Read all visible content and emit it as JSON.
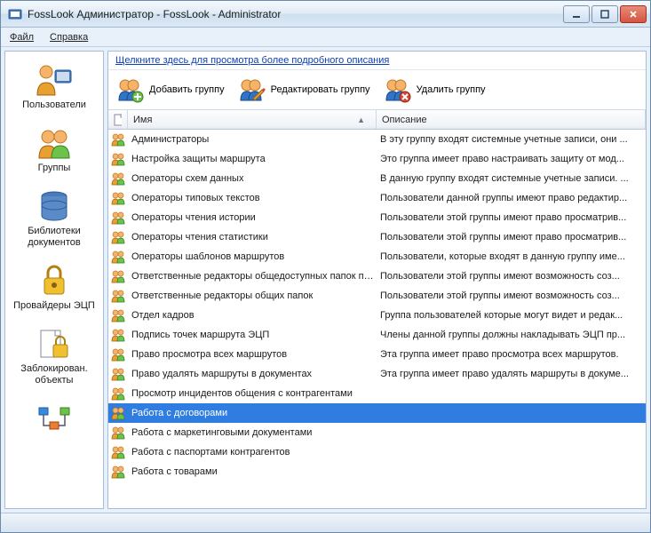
{
  "window": {
    "title": "FossLook Администратор - FossLook - Administrator"
  },
  "menubar": {
    "file": {
      "label": "Файл",
      "underline_index": 0
    },
    "help": {
      "label": "Справка",
      "underline_index": 0
    }
  },
  "sidebar": {
    "items": [
      {
        "icon": "users-icon",
        "label": "Пользователи"
      },
      {
        "icon": "group-icon",
        "label": "Группы"
      },
      {
        "icon": "database-icon",
        "label": "Библиотеки документов"
      },
      {
        "icon": "lock-icon",
        "label": "Провайдеры ЭЦП"
      },
      {
        "icon": "page-lock-icon",
        "label": "Заблокирован. объекты"
      },
      {
        "icon": "tree-icon",
        "label": ""
      }
    ]
  },
  "main": {
    "infolink": "Щелкните здесь для просмотра более подробного описания",
    "toolbar": {
      "add": {
        "label": "Добавить группу"
      },
      "edit": {
        "label": "Редактировать группу"
      },
      "delete": {
        "label": "Удалить группу"
      }
    },
    "columns": {
      "name": "Имя",
      "desc": "Описание"
    },
    "rows": [
      {
        "name": "Администраторы",
        "desc": "В эту группу входят системные учетные записи, они ...",
        "selected": false
      },
      {
        "name": "Настройка защиты маршрута",
        "desc": "Это группа имеет право настраивать защиту от мод...",
        "selected": false
      },
      {
        "name": "Операторы схем данных",
        "desc": "В данную группу входят системные учетные записи. ...",
        "selected": false
      },
      {
        "name": "Операторы типовых текстов",
        "desc": "Пользователи данной группы имеют право редактир...",
        "selected": false
      },
      {
        "name": "Операторы чтения истории",
        "desc": "Пользователи этой группы имеют право просматрив...",
        "selected": false
      },
      {
        "name": "Операторы чтения статистики",
        "desc": "Пользователи этой группы имеют право просматрив...",
        "selected": false
      },
      {
        "name": "Операторы шаблонов маршрутов",
        "desc": "Пользователи, которые входят в данную группу име...",
        "selected": false
      },
      {
        "name": "Ответственные редакторы общедоступных папок по...",
        "desc": "Пользователи этой группы имеют возможность соз...",
        "selected": false
      },
      {
        "name": "Ответственные редакторы общих папок",
        "desc": "Пользователи этой группы имеют возможность соз...",
        "selected": false
      },
      {
        "name": "Отдел кадров",
        "desc": "Группа пользователей которые могут видет и редак...",
        "selected": false
      },
      {
        "name": "Подпись точек маршрута ЭЦП",
        "desc": "Члены данной группы должны накладывать ЭЦП пр...",
        "selected": false
      },
      {
        "name": "Право просмотра всех маршрутов",
        "desc": "Эта группа имеет право просмотра всех маршрутов.",
        "selected": false
      },
      {
        "name": "Право удалять маршруты в документах",
        "desc": "Эта группа имеет право удалять маршруты в докуме...",
        "selected": false
      },
      {
        "name": "Просмотр инцидентов общения с контрагентами",
        "desc": "",
        "selected": false
      },
      {
        "name": "Работа с договорами",
        "desc": "",
        "selected": true
      },
      {
        "name": "Работа с маркетинговыми документами",
        "desc": "",
        "selected": false
      },
      {
        "name": "Работа с паспортами контрагентов",
        "desc": "",
        "selected": false
      },
      {
        "name": "Работа с товарами",
        "desc": "",
        "selected": false
      }
    ]
  }
}
